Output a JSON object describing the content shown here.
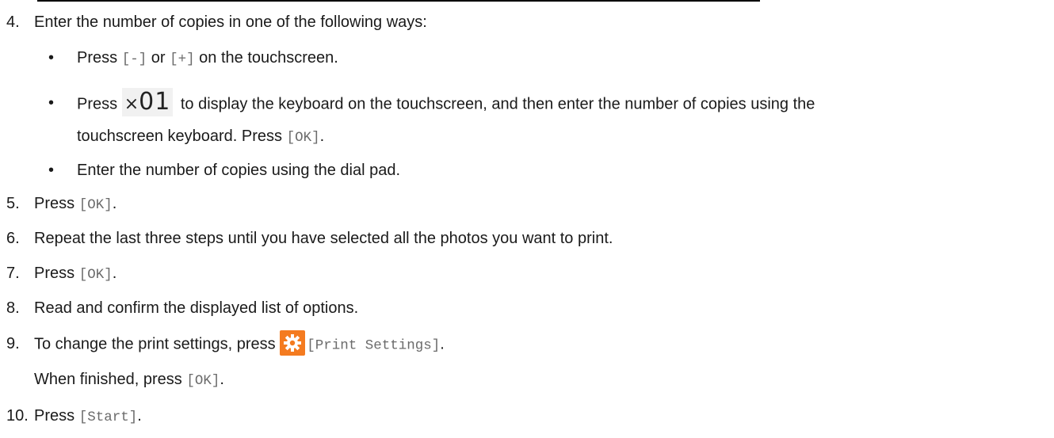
{
  "steps": {
    "s4": {
      "num": "4.",
      "text": "Enter the number of copies in one of the following ways:"
    },
    "b1": {
      "pre": "Press ",
      "minus": "[-]",
      "mid": " or ",
      "plus": "[+]",
      "post": " on the touchscreen."
    },
    "b2": {
      "pre": "Press ",
      "badge_x": "×",
      "badge_num": "01",
      "post": " to display the keyboard on the touchscreen, and then enter the number of copies using the",
      "line2_pre": "touchscreen keyboard. Press ",
      "line2_ok": "[OK]",
      "line2_post": "."
    },
    "b3": {
      "text": "Enter the number of copies using the dial pad."
    },
    "s5": {
      "num": "5.",
      "pre": "Press ",
      "ok": "[OK]",
      "post": "."
    },
    "s6": {
      "num": "6.",
      "text": "Repeat the last three steps until you have selected all the photos you want to print."
    },
    "s7": {
      "num": "7.",
      "pre": "Press ",
      "ok": "[OK]",
      "post": "."
    },
    "s8": {
      "num": "8.",
      "text": "Read and confirm the displayed list of options."
    },
    "s9": {
      "num": "9.",
      "pre": "To change the print settings, press ",
      "icon": "gear-icon",
      "settings": "[Print Settings]",
      "post": ".",
      "line2_pre": "When finished, press ",
      "line2_ok": "[OK]",
      "line2_post": "."
    },
    "s10": {
      "num": "10.",
      "pre": "Press ",
      "start": "[Start]",
      "post": "."
    }
  },
  "colors": {
    "gear_button": "#f47b20",
    "mono_text": "#6b6b6b"
  },
  "bullet_char": "•"
}
